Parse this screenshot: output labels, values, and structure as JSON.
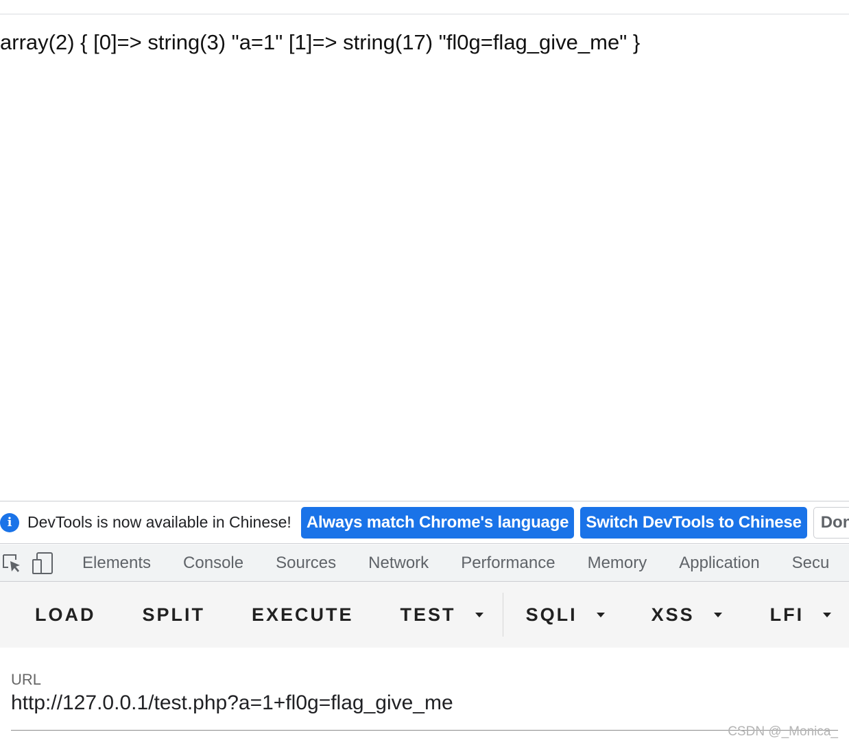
{
  "page": {
    "output_text": "array(2) { [0]=> string(3) \"a=1\" [1]=> string(17) \"fl0g=flag_give_me\" }"
  },
  "devtools": {
    "infobar": {
      "icon": "info-icon",
      "message": "DevTools is now available in Chinese!",
      "match_language_label": "Always match Chrome's language",
      "switch_language_label": "Switch DevTools to Chinese",
      "dismiss_label": "Don"
    },
    "tabs": [
      "Elements",
      "Console",
      "Sources",
      "Network",
      "Performance",
      "Memory",
      "Application",
      "Secu"
    ],
    "tool_icons": [
      "inspect-element-icon",
      "device-toolbar-icon"
    ]
  },
  "hackbar": {
    "buttons": {
      "load": "LOAD",
      "split": "SPLIT",
      "execute": "EXECUTE",
      "test": "TEST",
      "sqli": "SQLI",
      "xss": "XSS",
      "lfi": "LFI"
    },
    "url_label": "URL",
    "url_value": "http://127.0.0.1/test.php?a=1+fl0g=flag_give_me"
  },
  "watermark": "CSDN @_Monica_",
  "colors": {
    "accent": "#1a73e8",
    "tabbar_bg": "#f1f3f4",
    "hackbar_bg": "#f5f5f5"
  }
}
